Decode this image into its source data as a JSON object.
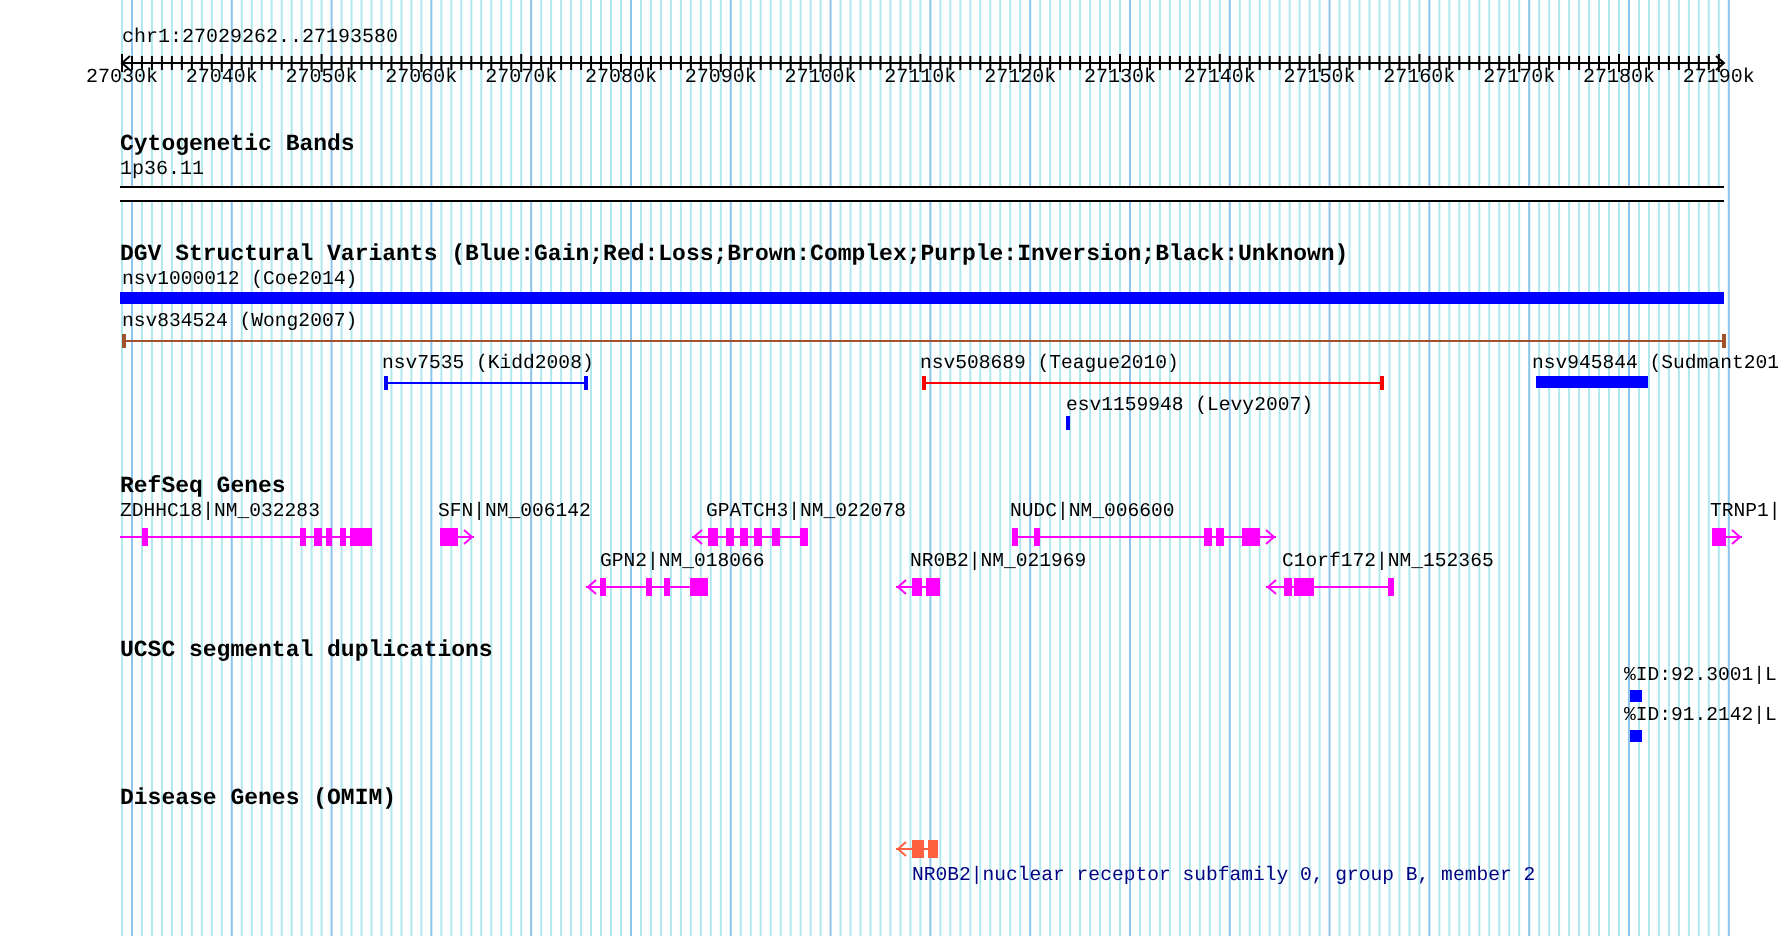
{
  "location": "chr1:27029262..27193580",
  "ruler": {
    "ticks": [
      "27030k",
      "27040k",
      "27050k",
      "27060k",
      "27070k",
      "27080k",
      "27090k",
      "27100k",
      "27110k",
      "27120k",
      "27130k",
      "27140k",
      "27150k",
      "27160k",
      "27170k",
      "27180k",
      "27190k"
    ]
  },
  "tracks": [
    {
      "kind": "bands",
      "title": "Cytogenetic Bands",
      "band": "1p36.11"
    },
    {
      "kind": "variants",
      "title": "DGV Structural Variants (Blue:Gain;Red:Loss;Brown:Complex;Purple:Inversion;Black:Unknown)",
      "features": [
        {
          "label": "nsv1000012 (Coe2014)",
          "color": "#0000ff"
        },
        {
          "label": "nsv834524 (Wong2007)",
          "color": "#a0522d"
        },
        {
          "label": "nsv7535 (Kidd2008)",
          "color": "#0000ff"
        },
        {
          "label": "nsv508689 (Teague2010)",
          "color": "#ff0000"
        },
        {
          "label": "nsv945844 (Sudmant201",
          "color": "#0000ff"
        },
        {
          "label": "esv1159948 (Levy2007)",
          "color": "#0000ff"
        }
      ]
    },
    {
      "kind": "genes",
      "title": "RefSeq Genes",
      "features": [
        {
          "label": "ZDHHC18|NM_032283"
        },
        {
          "label": "SFN|NM_006142"
        },
        {
          "label": "GPATCH3|NM_022078"
        },
        {
          "label": "NUDC|NM_006600"
        },
        {
          "label": "TRNP1|"
        },
        {
          "label": "GPN2|NM_018066"
        },
        {
          "label": "NR0B2|NM_021969"
        },
        {
          "label": "C1orf172|NM_152365"
        }
      ]
    },
    {
      "kind": "dups",
      "title": "UCSC segmental duplications",
      "features": [
        {
          "label": "%ID:92.3001|L"
        },
        {
          "label": "%ID:91.2142|L"
        }
      ]
    },
    {
      "kind": "omim",
      "title": "Disease Genes (OMIM)",
      "features": [
        {
          "label": "NR0B2|nuclear receptor subfamily 0, group B, member 2"
        }
      ]
    }
  ]
}
